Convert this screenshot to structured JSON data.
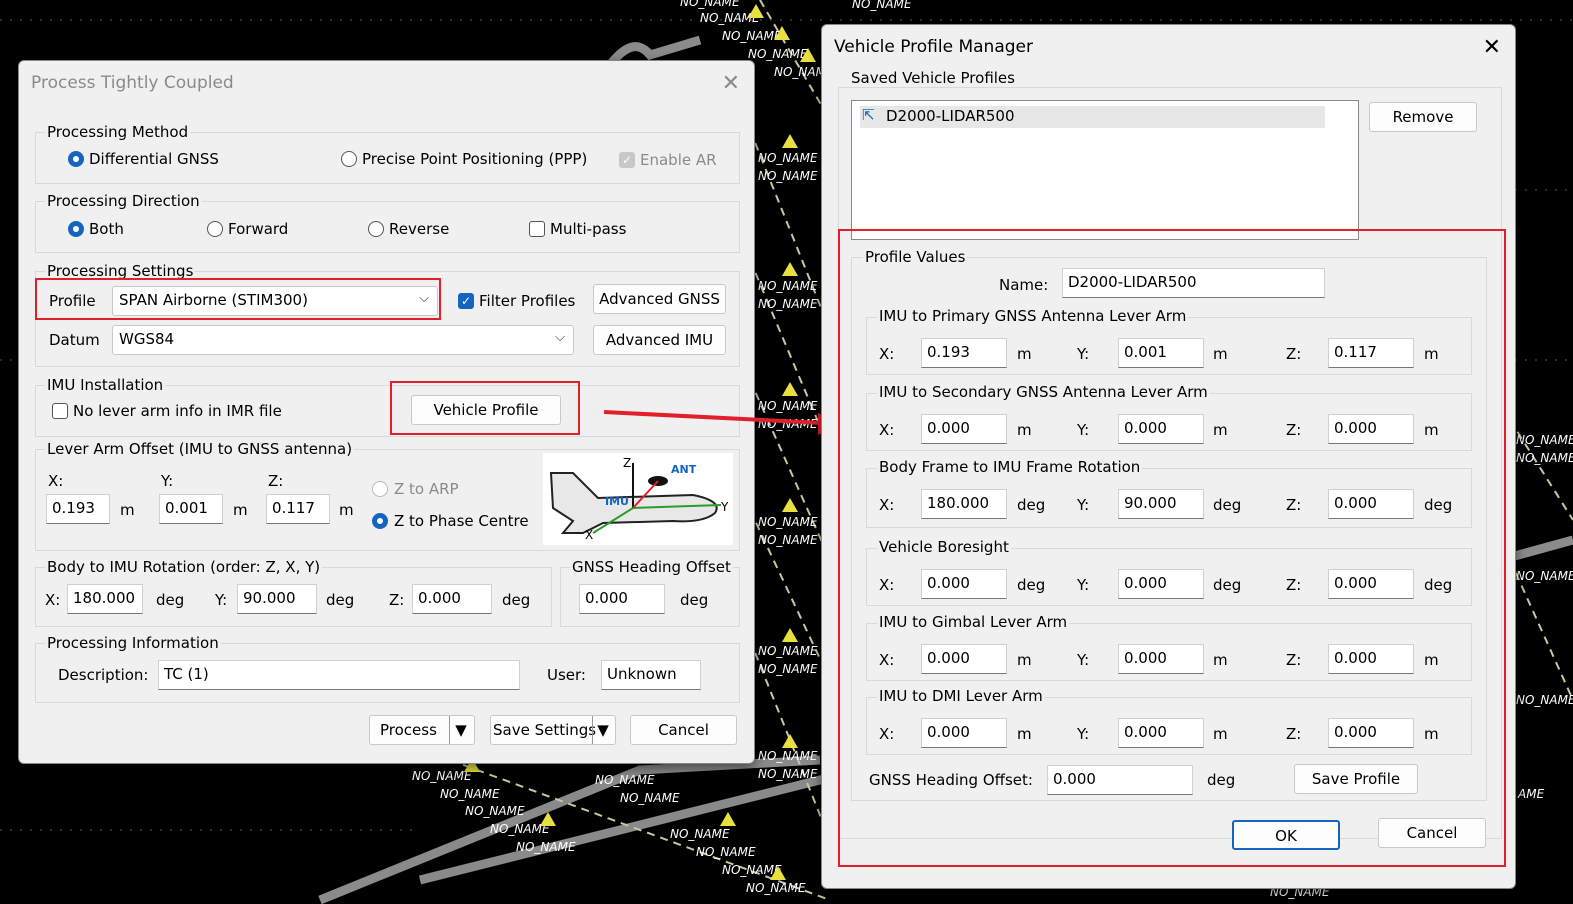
{
  "background": {
    "map_label": "NO_NAME",
    "extra_label": "AME"
  },
  "process_dialog": {
    "title": "Process Tightly Coupled",
    "processing_method": {
      "label": "Processing Method",
      "option_dgnss": "Differential GNSS",
      "option_ppp": "Precise Point Positioning (PPP)",
      "enable_ar": "Enable AR",
      "selected": "Differential GNSS"
    },
    "processing_direction": {
      "label": "Processing Direction",
      "both": "Both",
      "forward": "Forward",
      "reverse": "Reverse",
      "multipass": "Multi-pass",
      "selected": "Both"
    },
    "processing_settings": {
      "label": "Processing Settings",
      "profile_label": "Profile",
      "profile_value": "SPAN Airborne (STIM300)",
      "filter_profiles": "Filter Profiles",
      "advanced_gnss": "Advanced GNSS",
      "datum_label": "Datum",
      "datum_value": "WGS84",
      "advanced_imu": "Advanced IMU"
    },
    "imu_installation": {
      "label": "IMU Installation",
      "no_lever_arm": "No lever arm info in IMR file",
      "vehicle_profile": "Vehicle Profile"
    },
    "lever_arm": {
      "label": "Lever Arm Offset (IMU to GNSS antenna)",
      "x_label": "X:",
      "y_label": "Y:",
      "z_label": "Z:",
      "x": "0.193",
      "y": "0.001",
      "z": "0.117",
      "unit": "m",
      "z_to_arp": "Z to ARP",
      "z_to_phase": "Z to Phase Centre",
      "diagram_ant": "ANT",
      "diagram_imu": "IMU",
      "diagram_x": "X",
      "diagram_y": "Y",
      "diagram_z": "Z"
    },
    "body_rotation": {
      "label": "Body to IMU Rotation (order: Z, X, Y)",
      "x_label": "X:",
      "y_label": "Y:",
      "z_label": "Z:",
      "x": "180.000",
      "y": "90.000",
      "z": "0.000",
      "unit": "deg"
    },
    "heading_offset": {
      "label": "GNSS Heading Offset",
      "value": "0.000",
      "unit": "deg"
    },
    "processing_info": {
      "label": "Processing Information",
      "description_label": "Description:",
      "description": "TC (1)",
      "user_label": "User:",
      "user": "Unknown"
    },
    "buttons": {
      "process": "Process",
      "save_settings": "Save Settings",
      "cancel": "Cancel"
    }
  },
  "vpm_dialog": {
    "title": "Vehicle Profile Manager",
    "saved_label": "Saved Vehicle Profiles",
    "profiles": [
      "D2000-LIDAR500"
    ],
    "remove": "Remove",
    "profile_values_label": "Profile Values",
    "name_label": "Name:",
    "name_value": "D2000-LIDAR500",
    "sections": [
      {
        "label": "IMU to Primary GNSS Antenna Lever Arm",
        "x": "0.193",
        "y": "0.001",
        "z": "0.117",
        "unit": "m"
      },
      {
        "label": "IMU to Secondary GNSS Antenna Lever Arm",
        "x": "0.000",
        "y": "0.000",
        "z": "0.000",
        "unit": "m"
      },
      {
        "label": "Body Frame to IMU Frame Rotation",
        "x": "180.000",
        "y": "90.000",
        "z": "0.000",
        "unit": "deg"
      },
      {
        "label": "Vehicle Boresight",
        "x": "0.000",
        "y": "0.000",
        "z": "0.000",
        "unit": "deg"
      },
      {
        "label": "IMU to Gimbal Lever Arm",
        "x": "0.000",
        "y": "0.000",
        "z": "0.000",
        "unit": "m"
      },
      {
        "label": "IMU to DMI Lever Arm",
        "x": "0.000",
        "y": "0.000",
        "z": "0.000",
        "unit": "m"
      }
    ],
    "axis_labels": {
      "x": "X:",
      "y": "Y:",
      "z": "Z:"
    },
    "heading_label": "GNSS Heading Offset:",
    "heading_value": "0.000",
    "heading_unit": "deg",
    "save_profile": "Save Profile",
    "ok": "OK",
    "cancel": "Cancel"
  },
  "colors": {
    "highlight_red": "#e0202a",
    "accent_blue": "#1565c0"
  }
}
